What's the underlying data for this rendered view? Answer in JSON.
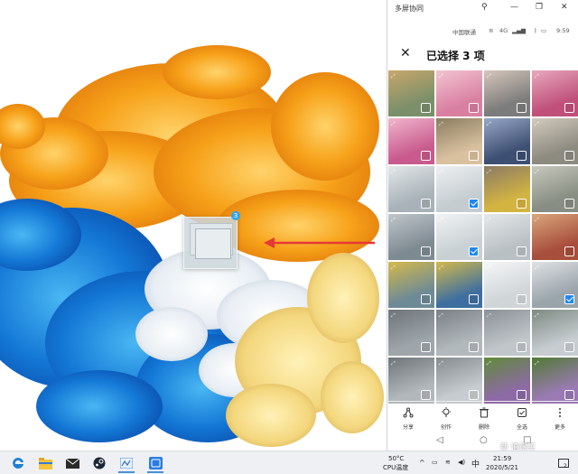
{
  "phone_window": {
    "title": "多屏协同",
    "status_bar": {
      "carrier": "中国联通",
      "signal_text": "4G",
      "time": "9:59"
    },
    "header": {
      "close_icon": "close-icon",
      "selection_title": "已选择 3 项"
    },
    "photos": [
      {
        "tone": [
          "#7a8f6a",
          "#c9a76b"
        ],
        "checked": false
      },
      {
        "tone": [
          "#d97fa0",
          "#f2c4d2"
        ],
        "checked": false
      },
      {
        "tone": [
          "#7c7c7c",
          "#d6c6bb"
        ],
        "checked": false
      },
      {
        "tone": [
          "#c0507a",
          "#e7a8bd"
        ],
        "checked": false
      },
      {
        "tone": [
          "#c85a8d",
          "#f0b5cc"
        ],
        "checked": false
      },
      {
        "tone": [
          "#d9c1a0",
          "#8b7d60"
        ],
        "checked": false
      },
      {
        "tone": [
          "#3d4f72",
          "#96a7c4"
        ],
        "checked": false
      },
      {
        "tone": [
          "#8d8a80",
          "#d2cbbd"
        ],
        "checked": false
      },
      {
        "tone": [
          "#a8b2b8",
          "#e2e6e8"
        ],
        "checked": false
      },
      {
        "tone": [
          "#c4ccd0",
          "#eef0f1"
        ],
        "checked": true
      },
      {
        "tone": [
          "#d4b441",
          "#8a7a66"
        ],
        "checked": false
      },
      {
        "tone": [
          "#888e83",
          "#c7c8bd"
        ],
        "checked": false
      },
      {
        "tone": [
          "#7e8a92",
          "#c0c7cb"
        ],
        "checked": false
      },
      {
        "tone": [
          "#c8d0d3",
          "#f1f3f4"
        ],
        "checked": true
      },
      {
        "tone": [
          "#b9c0c4",
          "#e4e7e8"
        ],
        "checked": false
      },
      {
        "tone": [
          "#a84e3c",
          "#d8a67c"
        ],
        "checked": false
      },
      {
        "tone": [
          "#6e8a96",
          "#d3b94a"
        ],
        "checked": false
      },
      {
        "tone": [
          "#3f6fa0",
          "#d3b94a"
        ],
        "checked": false
      },
      {
        "tone": [
          "#d0d5d8",
          "#f5f6f7"
        ],
        "checked": false
      },
      {
        "tone": [
          "#9aa4ab",
          "#dfe2e4"
        ],
        "checked": true
      },
      {
        "tone": [
          "#9ea6ab",
          "#6e7479"
        ],
        "checked": false
      },
      {
        "tone": [
          "#b2b9bd",
          "#797f84"
        ],
        "checked": false
      },
      {
        "tone": [
          "#c0c6ca",
          "#8a9095"
        ],
        "checked": false
      },
      {
        "tone": [
          "#c6ccd0",
          "#7e8a82"
        ],
        "checked": false
      },
      {
        "tone": [
          "#b3b8bc",
          "#6f7478"
        ],
        "checked": false
      },
      {
        "tone": [
          "#c7ccd0",
          "#858b8f"
        ],
        "checked": false
      },
      {
        "tone": [
          "#8e6aa7",
          "#5f8a3a"
        ],
        "checked": false
      },
      {
        "tone": [
          "#9b7ab3",
          "#4f7a33"
        ],
        "checked": false
      }
    ],
    "actions": [
      {
        "icon": "share-icon",
        "label": "分享"
      },
      {
        "icon": "create-icon",
        "label": "创作"
      },
      {
        "icon": "delete-icon",
        "label": "删除"
      },
      {
        "icon": "select-all-icon",
        "label": "全选"
      },
      {
        "icon": "more-icon",
        "label": "更多"
      }
    ],
    "drag_badge_count": "3"
  },
  "taskbar": {
    "apps": [
      "edge-icon",
      "file-explorer-icon",
      "mail-icon",
      "steam-icon",
      "task-manager-icon",
      "multi-screen-icon"
    ],
    "temperature": "50°C",
    "cpu_label": "CPU温度",
    "ime": "中",
    "time": "21:59",
    "date": "2020/5/21",
    "notification_count": "2"
  },
  "watermark": "新 值得买",
  "colors": {
    "accent": "#1e88f0",
    "arrow": "#e53935"
  }
}
